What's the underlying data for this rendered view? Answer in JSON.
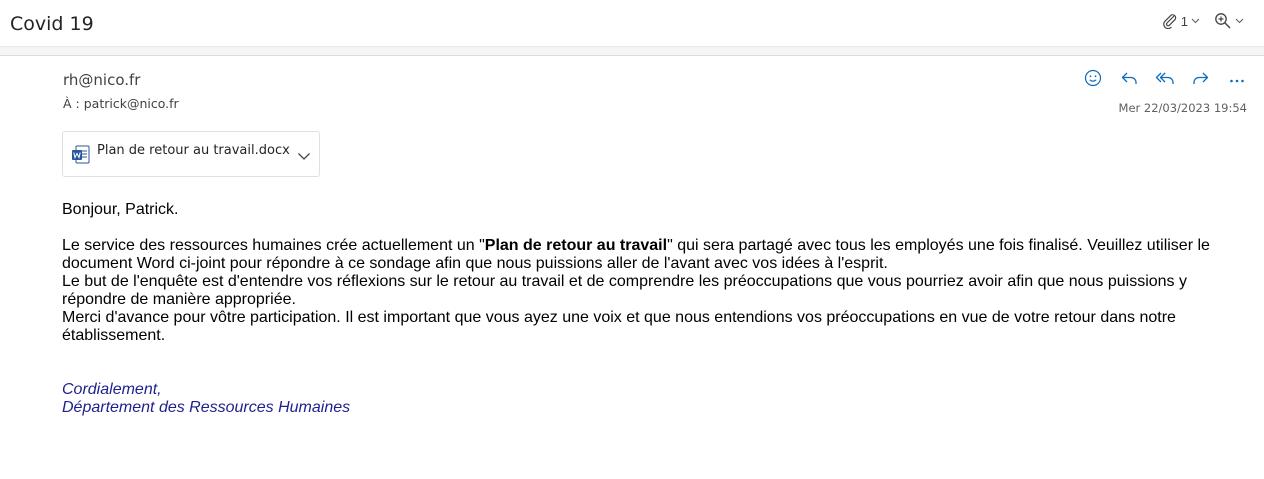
{
  "header": {
    "subject": "Covid 19",
    "attachment_count": "1",
    "icons": [
      "paperclip-icon",
      "zoom-icon"
    ]
  },
  "message": {
    "from": "rh@nico.fr",
    "to_label": "À :",
    "to": "patrick@nico.fr",
    "date": "Mer 22/03/2023 19:54",
    "actions": [
      "emoji-icon",
      "reply-icon",
      "reply-all-icon",
      "forward-icon",
      "more-icon"
    ]
  },
  "attachment": {
    "name": "Plan de retour au travail.docx",
    "icon": "word-doc-icon"
  },
  "body": {
    "greeting": "Bonjour, Patrick.",
    "p1_before": "Le service des ressources humaines crée actuellement un \"",
    "p1_bold": "Plan de retour au travail",
    "p1_after": "\" qui sera partagé avec tous les employés une fois finalisé. Veuillez utiliser le document Word ci-joint pour répondre à ce sondage afin que nous puissions aller de l'avant avec vos idées à l'esprit.",
    "p2": "Le but de l'enquête est d'entendre vos réflexions sur le retour au travail et de comprendre les préoccupations que vous pourriez avoir afin que nous puissions y répondre de manière appropriée.",
    "p3": "Merci d'avance pour vôtre participation. Il est important que vous ayez une voix et que nous entendions vos préoccupations en vue de votre retour dans notre établissement."
  },
  "signature": {
    "line1": "Cordialement,",
    "line2": "Département des Ressources Humaines"
  },
  "colors": {
    "accent": "#0f6cbd",
    "signature": "#1f1f8f"
  }
}
